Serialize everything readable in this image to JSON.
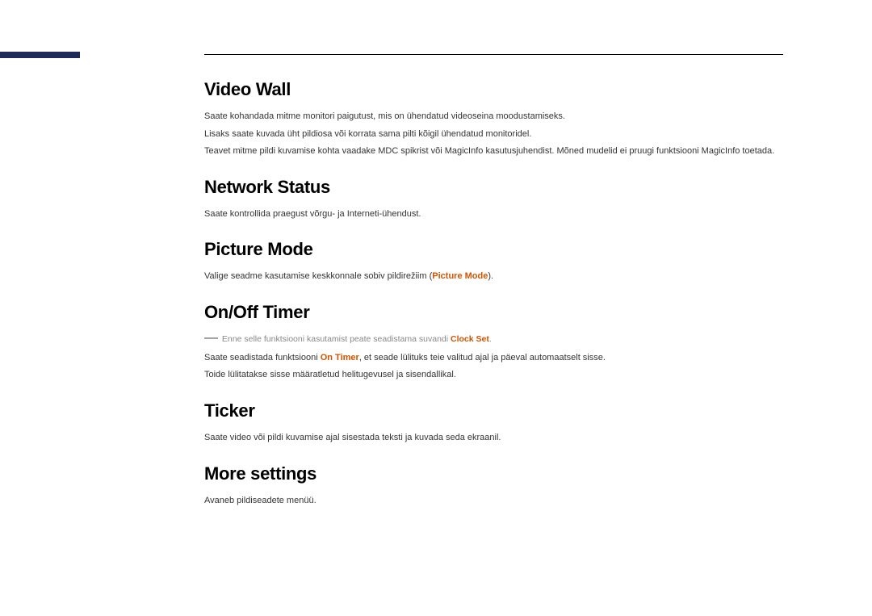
{
  "sections": {
    "video_wall": {
      "heading": "Video Wall",
      "p1": "Saate kohandada mitme monitori paigutust, mis on ühendatud videoseina moodustamiseks.",
      "p2": "Lisaks saate kuvada üht pildiosa või korrata sama pilti kõigil ühendatud monitoridel.",
      "p3": "Teavet mitme pildi kuvamise kohta vaadake MDC spikrist või MagicInfo kasutusjuhendist. Mõned mudelid ei pruugi funktsiooni MagicInfo toetada."
    },
    "network_status": {
      "heading": "Network Status",
      "p1": "Saate kontrollida praegust võrgu- ja Interneti-ühendust."
    },
    "picture_mode": {
      "heading": "Picture Mode",
      "p1_pre": "Valige seadme kasutamise keskkonnale sobiv pildirežiim (",
      "p1_strong": "Picture Mode",
      "p1_post": ")."
    },
    "on_off_timer": {
      "heading": "On/Off Timer",
      "note_pre": "Enne selle funktsiooni kasutamist peate seadistama suvandi ",
      "note_strong": "Clock Set",
      "note_post": ".",
      "p1_pre": "Saate seadistada funktsiooni ",
      "p1_strong": "On Timer",
      "p1_post": ", et seade lülituks teie valitud ajal ja päeval automaatselt sisse.",
      "p2": "Toide lülitatakse sisse määratletud helitugevusel ja sisendallikal."
    },
    "ticker": {
      "heading": "Ticker",
      "p1": "Saate video või pildi kuvamise ajal sisestada teksti ja kuvada seda ekraanil."
    },
    "more_settings": {
      "heading": "More settings",
      "p1": "Avaneb pildiseadete menüü."
    }
  }
}
